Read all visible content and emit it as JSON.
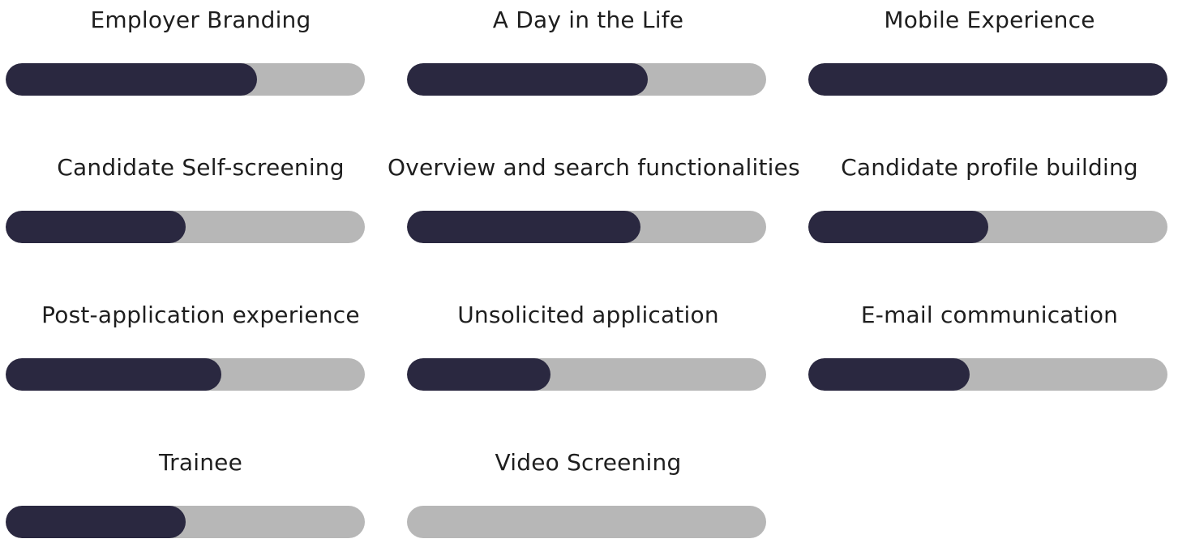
{
  "colors": {
    "fill": "#2a2840",
    "track": "#b7b7b7",
    "text": "#1e1e1e"
  },
  "skills": [
    {
      "label": "Employer Branding",
      "progress": 0.7
    },
    {
      "label": "A Day in the Life",
      "progress": 0.67
    },
    {
      "label": "Mobile Experience",
      "progress": 1.0
    },
    {
      "label": "Candidate Self-screening",
      "progress": 0.5
    },
    {
      "label": "Overview and search functionalities",
      "progress": 0.65
    },
    {
      "label": "Candidate profile building",
      "progress": 0.5
    },
    {
      "label": "Post-application experience",
      "progress": 0.6
    },
    {
      "label": "Unsolicited application",
      "progress": 0.4
    },
    {
      "label": "E-mail communication",
      "progress": 0.45
    },
    {
      "label": "Trainee",
      "progress": 0.5
    },
    {
      "label": "Video Screening",
      "progress": 0.0
    }
  ]
}
